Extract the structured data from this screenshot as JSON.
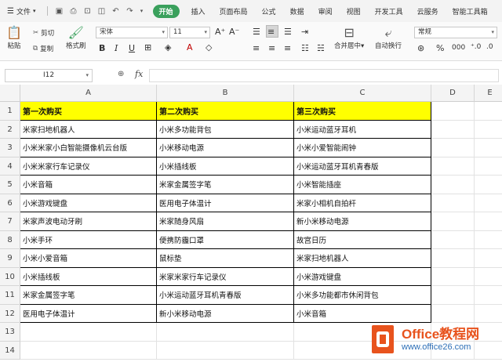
{
  "menubar": {
    "file_label": "文件",
    "tabs": [
      "开始",
      "插入",
      "页面布局",
      "公式",
      "数据",
      "审阅",
      "视图",
      "开发工具",
      "云服务",
      "智能工具箱"
    ],
    "active_tab": "开始"
  },
  "ribbon": {
    "paste": "粘贴",
    "cut": "剪切",
    "copy": "复制",
    "format_painter": "格式刷",
    "font_name": "宋体",
    "font_size": "11",
    "merge_center": "合并居中",
    "wrap_text": "自动换行",
    "number_format": "常规"
  },
  "formula_bar": {
    "name_box": "I12",
    "fx": "fx",
    "content": ""
  },
  "sheet": {
    "columns": [
      "A",
      "B",
      "C",
      "D",
      "E"
    ],
    "rows": [
      "1",
      "2",
      "3",
      "4",
      "5",
      "6",
      "7",
      "8",
      "9",
      "10",
      "11",
      "12",
      "13",
      "14"
    ],
    "header": [
      "第一次购买",
      "第二次购买",
      "第三次购买"
    ],
    "data": [
      [
        "米家扫地机器人",
        "小米多功能背包",
        "小米运动蓝牙耳机"
      ],
      [
        "小米米家小白智能摄像机云台版",
        "小米移动电源",
        "小米小爱智能闹钟"
      ],
      [
        "小米米家行车记录仪",
        "小米插线板",
        "小米运动蓝牙耳机青春版"
      ],
      [
        "小米音箱",
        "米家金属签字笔",
        "小米智能插座"
      ],
      [
        "小米游戏键盘",
        "医用电子体温计",
        "米家小相机自拍杆"
      ],
      [
        "米家声波电动牙刷",
        "米家随身风扇",
        "新小米移动电源"
      ],
      [
        "小米手环",
        "便携防霾口罩",
        "故宫日历"
      ],
      [
        "小米小爱音箱",
        "鼠标垫",
        "米家扫地机器人"
      ],
      [
        "小米插线板",
        "米家米家行车记录仪",
        "小米游戏键盘"
      ],
      [
        "米家金属签字笔",
        "小米运动蓝牙耳机青春版",
        "小米多功能都市休闲背包"
      ],
      [
        "医用电子体温计",
        "新小米移动电源",
        "小米音箱"
      ]
    ]
  },
  "watermark": {
    "title": "Office教程网",
    "url": "www.office26.com"
  }
}
